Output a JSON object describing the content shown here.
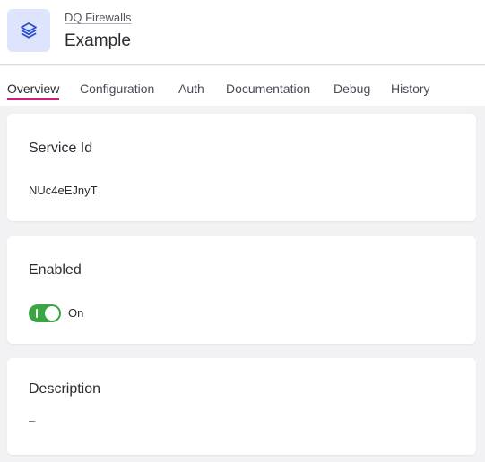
{
  "header": {
    "breadcrumb": "DQ Firewalls",
    "title": "Example",
    "icon": "layers-icon",
    "icon_color": "#2b4fd0"
  },
  "tabs": [
    {
      "label": "Overview",
      "active": true
    },
    {
      "label": "Configuration",
      "active": false
    },
    {
      "label": "Auth",
      "active": false
    },
    {
      "label": "Documentation",
      "active": false
    },
    {
      "label": "Debug",
      "active": false
    },
    {
      "label": "History",
      "active": false
    }
  ],
  "accent_color": "#d6197a",
  "service_id": {
    "title": "Service Id",
    "value": "NUc4eEJnyT"
  },
  "enabled": {
    "title": "Enabled",
    "state_label": "On",
    "value": true,
    "toggle_color": "#3aa541"
  },
  "description": {
    "title": "Description",
    "value": "–"
  }
}
